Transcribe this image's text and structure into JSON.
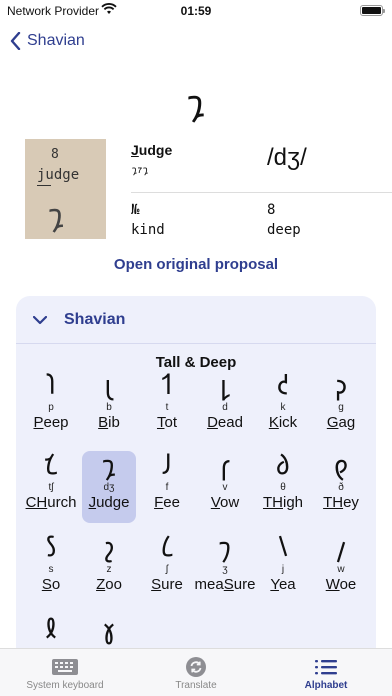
{
  "status": {
    "carrier": "Network Provider",
    "time": "01:59"
  },
  "nav": {
    "back_label": "Shavian"
  },
  "current_letter": {
    "glyph": "𐑡",
    "word_first": "J",
    "word_rest": "udge",
    "shavian_spelling": "𐑡𐑳𐑡",
    "ipa": "/dʒ/",
    "number_label": "№",
    "number_value": "8",
    "kind_label": "kind",
    "kind_value": "deep",
    "proposal_sheet": {
      "number": "8",
      "word": "judge",
      "glyph": "𐑡"
    }
  },
  "open_proposal_label": "Open original proposal",
  "alphabet_section": {
    "header": "Shavian",
    "subtitle": "Tall & Deep",
    "letters": [
      {
        "glyph": "𐑐",
        "ipa": "p",
        "pre": "",
        "key": "P",
        "post": "eep",
        "selected": false
      },
      {
        "glyph": "𐑚",
        "ipa": "b",
        "pre": "",
        "key": "B",
        "post": "ib",
        "selected": false
      },
      {
        "glyph": "𐑑",
        "ipa": "t",
        "pre": "",
        "key": "T",
        "post": "ot",
        "selected": false
      },
      {
        "glyph": "𐑛",
        "ipa": "d",
        "pre": "",
        "key": "D",
        "post": "ead",
        "selected": false
      },
      {
        "glyph": "𐑒",
        "ipa": "k",
        "pre": "",
        "key": "K",
        "post": "ick",
        "selected": false
      },
      {
        "glyph": "𐑜",
        "ipa": "g",
        "pre": "",
        "key": "G",
        "post": "ag",
        "selected": false
      },
      {
        "glyph": "𐑗",
        "ipa": "tʃ",
        "pre": "",
        "key": "CH",
        "post": "urch",
        "selected": false
      },
      {
        "glyph": "𐑡",
        "ipa": "dʒ",
        "pre": "",
        "key": "J",
        "post": "udge",
        "selected": true
      },
      {
        "glyph": "𐑓",
        "ipa": "f",
        "pre": "",
        "key": "F",
        "post": "ee",
        "selected": false
      },
      {
        "glyph": "𐑝",
        "ipa": "v",
        "pre": "",
        "key": "V",
        "post": "ow",
        "selected": false
      },
      {
        "glyph": "𐑔",
        "ipa": "θ",
        "pre": "",
        "key": "TH",
        "post": "igh",
        "selected": false
      },
      {
        "glyph": "𐑞",
        "ipa": "ð",
        "pre": "",
        "key": "TH",
        "post": "ey",
        "selected": false
      },
      {
        "glyph": "𐑕",
        "ipa": "s",
        "pre": "",
        "key": "S",
        "post": "o",
        "selected": false
      },
      {
        "glyph": "𐑟",
        "ipa": "z",
        "pre": "",
        "key": "Z",
        "post": "oo",
        "selected": false
      },
      {
        "glyph": "𐑖",
        "ipa": "ʃ",
        "pre": "",
        "key": "S",
        "post": "ure",
        "selected": false
      },
      {
        "glyph": "𐑠",
        "ipa": "ʒ",
        "pre": "mea",
        "key": "S",
        "post": "ure",
        "selected": false
      },
      {
        "glyph": "𐑘",
        "ipa": "j",
        "pre": "",
        "key": "Y",
        "post": "ea",
        "selected": false
      },
      {
        "glyph": "𐑢",
        "ipa": "w",
        "pre": "",
        "key": "W",
        "post": "oe",
        "selected": false
      },
      {
        "glyph": "𐑙",
        "ipa": "",
        "pre": "",
        "key": "",
        "post": "",
        "selected": false
      },
      {
        "glyph": "𐑣",
        "ipa": "",
        "pre": "",
        "key": "",
        "post": "",
        "selected": false
      }
    ]
  },
  "tabs": [
    {
      "label": "System keyboard",
      "icon": "keyboard-icon",
      "active": false
    },
    {
      "label": "Translate",
      "icon": "translate-icon",
      "active": false
    },
    {
      "label": "Alphabet",
      "icon": "list-icon",
      "active": true
    }
  ],
  "colors": {
    "accent": "#2f3e8f",
    "card_bg": "#eef0fb",
    "selected_bg": "#c5cbed"
  }
}
